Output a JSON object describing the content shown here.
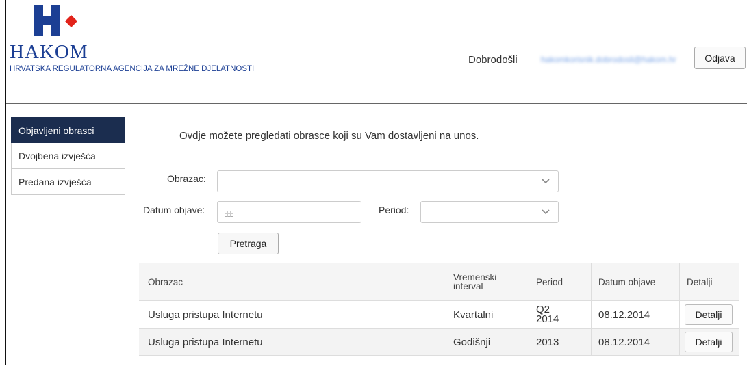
{
  "header": {
    "brand_name": "HAKOM",
    "brand_subtitle": "HRVATSKA REGULATORNA AGENCIJA ZA MREŽNE DJELATNOSTI",
    "welcome": "Dobrodošli",
    "user_email": "hakomkorisnik.dobrodosli@hakom.hr",
    "logout_label": "Odjava",
    "brand_colors": {
      "blue": "#1c3f94",
      "red": "#e2231a"
    }
  },
  "sidebar": {
    "items": [
      {
        "label": "Objavljeni obrasci",
        "active": true
      },
      {
        "label": "Dvojbena izvješća",
        "active": false
      },
      {
        "label": "Predana izvješća",
        "active": false
      }
    ]
  },
  "main": {
    "intro": "Ovdje možete pregledati obrasce koji su Vam dostavljeni na unos.",
    "filters": {
      "form_label": "Obrazac:",
      "form_value": "",
      "date_label": "Datum objave:",
      "date_value": "",
      "period_label": "Period:",
      "period_value": ""
    },
    "search_label": "Pretraga",
    "table": {
      "headers": [
        "Obrazac",
        "Vremenski interval",
        "Period",
        "Datum objave",
        "Detalji"
      ],
      "rows": [
        {
          "obrazac": "Usluga pristupa Internetu",
          "interval": "Kvartalni",
          "period_a": "Q2",
          "period_b": "2014",
          "datum": "08.12.2014",
          "detalji": "Detalji"
        },
        {
          "obrazac": "Usluga pristupa Internetu",
          "interval": "Godišnji",
          "period": "2013",
          "datum": "08.12.2014",
          "detalji": "Detalji"
        }
      ]
    }
  }
}
